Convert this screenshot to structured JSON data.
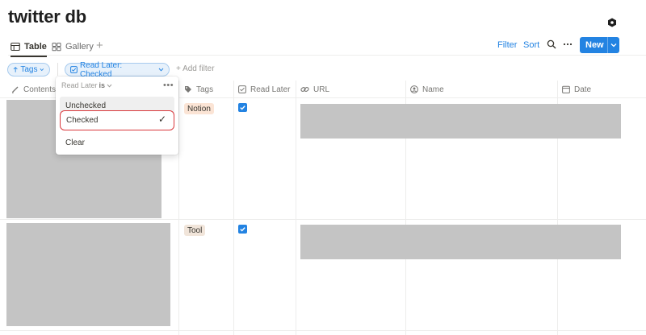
{
  "page": {
    "title": "twitter db"
  },
  "views": {
    "tabs": [
      {
        "label": "Table",
        "icon": "table-icon",
        "active": true
      },
      {
        "label": "Gallery",
        "icon": "gallery-icon",
        "active": false
      }
    ],
    "add_icon": "plus-icon"
  },
  "toolbar": {
    "filter_label": "Filter",
    "sort_label": "Sort",
    "search_icon": "search-icon",
    "more_icon": "more-icon",
    "new_label": "New"
  },
  "filters": {
    "sort_chip": "Tags",
    "filter_chip": "Read Later: Checked",
    "add_filter_label": "+ Add filter"
  },
  "columns": [
    {
      "label": "Contents",
      "icon": "pencil-icon"
    },
    {
      "label": "Tags",
      "icon": "tag-icon"
    },
    {
      "label": "Read Later",
      "icon": "checkbox-icon"
    },
    {
      "label": "URL",
      "icon": "link-icon"
    },
    {
      "label": "Name",
      "icon": "person-icon"
    },
    {
      "label": "Date",
      "icon": "calendar-icon"
    }
  ],
  "rows": [
    {
      "tag": "Notion",
      "read_later": true
    },
    {
      "tag": "Tool",
      "read_later": true
    }
  ],
  "dropdown": {
    "header_property": "Read Later",
    "header_operator": "is",
    "options": [
      {
        "label": "Unchecked",
        "selected": false
      },
      {
        "label": "Checked",
        "selected": true
      },
      {
        "label": "Clear",
        "selected": false
      }
    ]
  },
  "colors": {
    "accent": "#2383e2",
    "highlight_outline": "#d9383c",
    "redacted_fill": "#c4c4c4"
  }
}
